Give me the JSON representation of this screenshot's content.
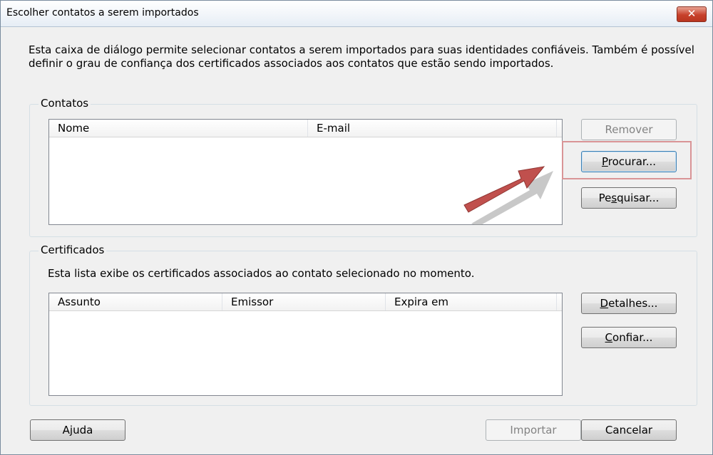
{
  "window": {
    "title": "Escolher contatos a serem importados",
    "close_glyph": "✕"
  },
  "intro_text": "Esta caixa de diálogo permite selecionar contatos a serem importados para suas identidades confiáveis. Também é possível definir o grau de confiança dos certificados associados aos contatos que estão sendo importados.",
  "contacts": {
    "legend": "Contatos",
    "columns": [
      "Nome",
      "E-mail"
    ],
    "rows": [],
    "buttons": {
      "remove": "Remover",
      "browse_pre": "",
      "browse_key": "P",
      "browse_post": "rocurar...",
      "search_pre": "Pe",
      "search_key": "s",
      "search_post": "quisar..."
    }
  },
  "certificates": {
    "legend": "Certificados",
    "description": "Esta lista exibe os certificados associados ao contato selecionado no momento.",
    "columns": [
      "Assunto",
      "Emissor",
      "Expira em"
    ],
    "rows": [],
    "buttons": {
      "details_pre": "",
      "details_key": "D",
      "details_post": "etalhes...",
      "trust_pre": "",
      "trust_key": "C",
      "trust_post": "onfiar..."
    }
  },
  "footer": {
    "help_pre": "A",
    "help_key": "j",
    "help_post": "uda",
    "import": "Importar",
    "cancel": "Cancelar"
  },
  "annotation": {
    "highlight_color": "#d99496",
    "arrow_color": "#c0504d"
  }
}
